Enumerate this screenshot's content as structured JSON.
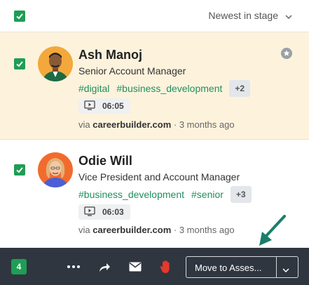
{
  "header": {
    "sort_label": "Newest in stage",
    "sort_icon": "chevron-down-icon"
  },
  "candidates": [
    {
      "name": "Ash Manoj",
      "title": "Senior Account Manager",
      "tags": [
        "#digital",
        "#business_development"
      ],
      "more_tags": "+2",
      "video_duration": "06:05",
      "source_prefix": "via",
      "source": "careerbuilder.com",
      "age": "· 3 months ago",
      "selected": true,
      "starred": true
    },
    {
      "name": "Odie Will",
      "title": "Vice President and Account Manager",
      "tags": [
        "#business_development",
        "#senior"
      ],
      "more_tags": "+3",
      "video_duration": "06:03",
      "source_prefix": "via",
      "source": "careerbuilder.com",
      "age": "· 3 months ago",
      "selected": true,
      "starred": false
    }
  ],
  "actions": {
    "selected_count": "4",
    "move_label": "Move to Asses...",
    "icons": [
      "more-icon",
      "share-icon",
      "email-icon",
      "reject-hand-icon",
      "chevron-down-icon"
    ]
  },
  "colors": {
    "accent_green": "#1f9d55",
    "tag_green": "#1f8f5f",
    "highlight_row": "#fdf3dc",
    "action_bar": "#2f3640",
    "annotation_arrow": "#1a7f6a"
  }
}
